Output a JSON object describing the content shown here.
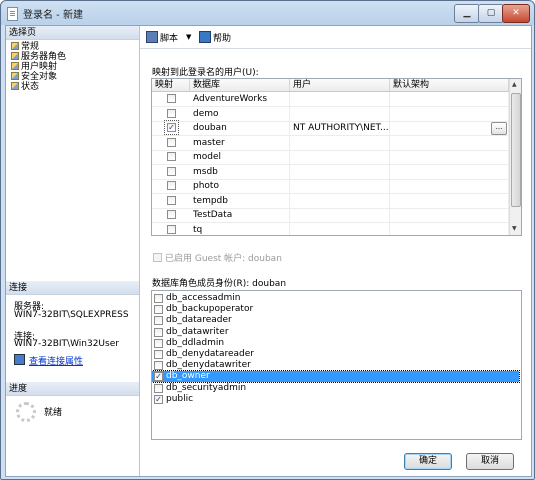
{
  "window": {
    "title": "登录名 - 新建"
  },
  "left": {
    "select_page_header": "选择页",
    "pages": [
      "常规",
      "服务器角色",
      "用户映射",
      "安全对象",
      "状态"
    ],
    "connection_header": "连接",
    "server_label": "服务器:",
    "server_value": "WIN7-32BIT\\SQLEXPRESS",
    "connection_label": "连接:",
    "connection_value": "WIN7-32BIT\\Win32User",
    "view_link": "查看连接属性",
    "progress_header": "进度",
    "progress_status": "就绪"
  },
  "toolbar": {
    "script_label": "脚本",
    "help_label": "帮助"
  },
  "mapping": {
    "label": "映射到此登录名的用户(U):",
    "columns": [
      "映射",
      "数据库",
      "用户",
      "默认架构"
    ],
    "rows": [
      {
        "checked": false,
        "db": "AdventureWorks",
        "user": "",
        "schema": ""
      },
      {
        "checked": false,
        "db": "demo",
        "user": "",
        "schema": ""
      },
      {
        "checked": true,
        "db": "douban",
        "user": "NT AUTHORITY\\NET...",
        "schema": ""
      },
      {
        "checked": false,
        "db": "master",
        "user": "",
        "schema": ""
      },
      {
        "checked": false,
        "db": "model",
        "user": "",
        "schema": ""
      },
      {
        "checked": false,
        "db": "msdb",
        "user": "",
        "schema": ""
      },
      {
        "checked": false,
        "db": "photo",
        "user": "",
        "schema": ""
      },
      {
        "checked": false,
        "db": "tempdb",
        "user": "",
        "schema": ""
      },
      {
        "checked": false,
        "db": "TestData",
        "user": "",
        "schema": ""
      },
      {
        "checked": false,
        "db": "tq",
        "user": "",
        "schema": ""
      }
    ],
    "ellipsis": "..."
  },
  "guest": {
    "label": "已启用 Guest 帐户: douban"
  },
  "roles": {
    "label": "数据库角色成员身份(R): douban",
    "items": [
      {
        "name": "db_accessadmin",
        "checked": false
      },
      {
        "name": "db_backupoperator",
        "checked": false
      },
      {
        "name": "db_datareader",
        "checked": false
      },
      {
        "name": "db_datawriter",
        "checked": false
      },
      {
        "name": "db_ddladmin",
        "checked": false
      },
      {
        "name": "db_denydatareader",
        "checked": false
      },
      {
        "name": "db_denydatawriter",
        "checked": false
      },
      {
        "name": "db_owner",
        "checked": true,
        "selected": true
      },
      {
        "name": "db_securityadmin",
        "checked": false
      },
      {
        "name": "public",
        "checked": true
      }
    ]
  },
  "footer": {
    "ok_label": "确定",
    "cancel_label": "取消"
  }
}
